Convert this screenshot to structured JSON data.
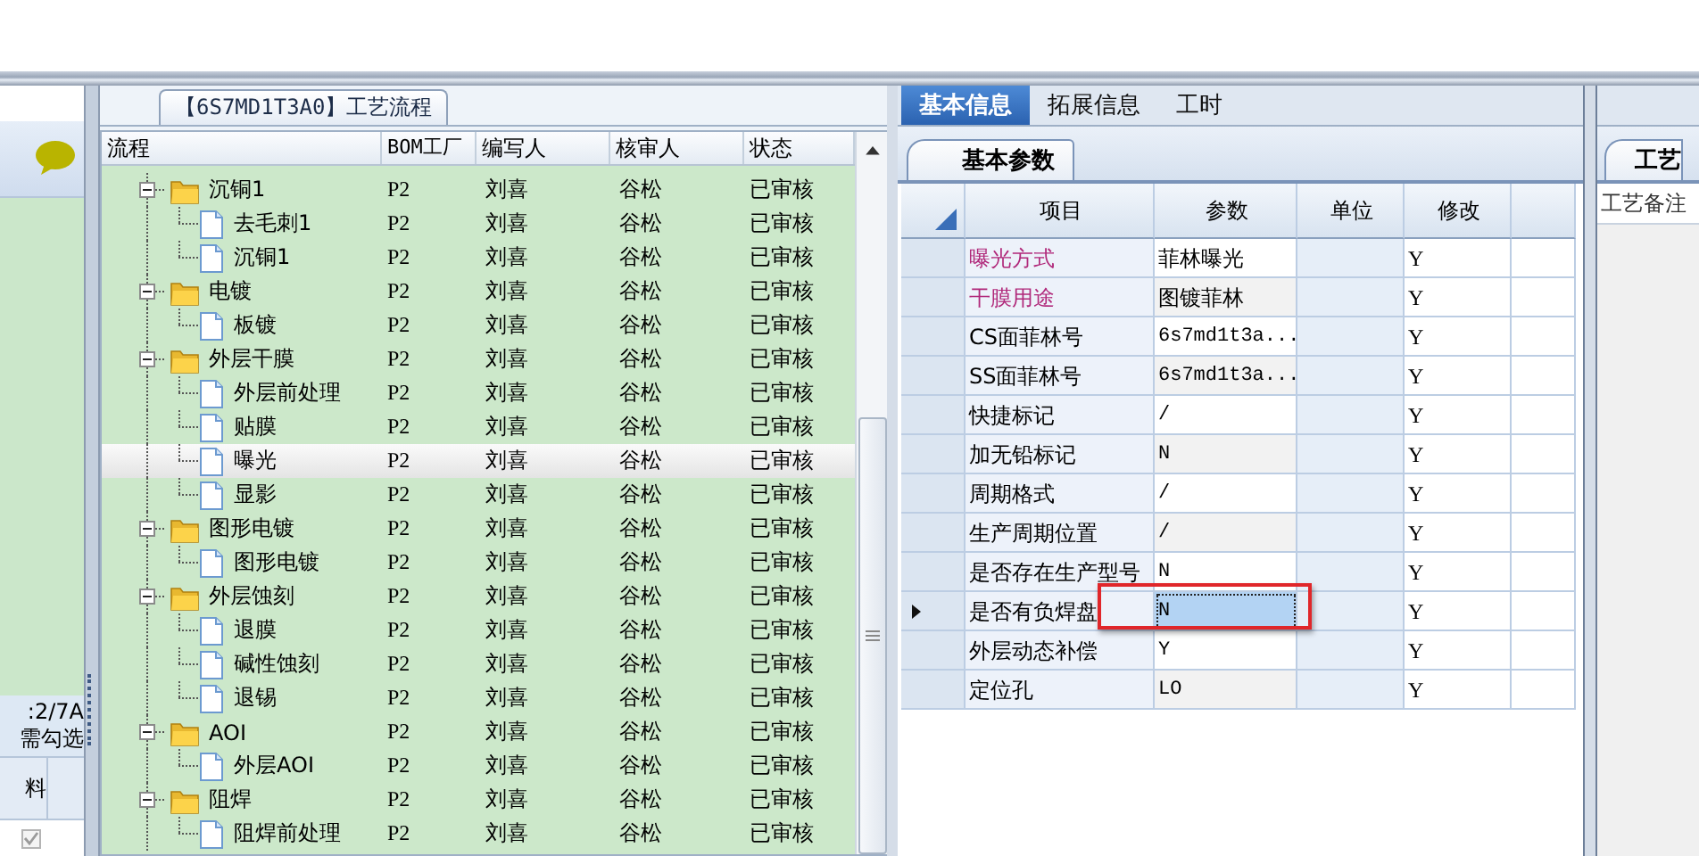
{
  "left_panel": {
    "summary": ":2/7A",
    "hint": "需勾选",
    "column_1": "料",
    "rows": [
      {
        "checked": true
      }
    ]
  },
  "flow": {
    "title": "【6S7MD1T3A0】工艺流程",
    "columns": [
      "流程",
      "BOM工厂",
      "编写人",
      "核审人",
      "状态"
    ],
    "tree": [
      {
        "label": "沉铜1",
        "bom": "P2",
        "author": "刘喜",
        "reviewer": "谷松",
        "status": "已审核",
        "expanded": true,
        "selected": false,
        "children": [
          {
            "label": "去毛刺1",
            "bom": "P2",
            "author": "刘喜",
            "reviewer": "谷松",
            "status": "已审核",
            "selected": false
          },
          {
            "label": "沉铜1",
            "bom": "P2",
            "author": "刘喜",
            "reviewer": "谷松",
            "status": "已审核",
            "selected": false
          }
        ]
      },
      {
        "label": "电镀",
        "bom": "P2",
        "author": "刘喜",
        "reviewer": "谷松",
        "status": "已审核",
        "expanded": true,
        "selected": false,
        "children": [
          {
            "label": "板镀",
            "bom": "P2",
            "author": "刘喜",
            "reviewer": "谷松",
            "status": "已审核",
            "selected": false
          }
        ]
      },
      {
        "label": "外层干膜",
        "bom": "P2",
        "author": "刘喜",
        "reviewer": "谷松",
        "status": "已审核",
        "expanded": true,
        "selected": false,
        "children": [
          {
            "label": "外层前处理",
            "bom": "P2",
            "author": "刘喜",
            "reviewer": "谷松",
            "status": "已审核",
            "selected": false
          },
          {
            "label": "贴膜",
            "bom": "P2",
            "author": "刘喜",
            "reviewer": "谷松",
            "status": "已审核",
            "selected": false
          },
          {
            "label": "曝光",
            "bom": "P2",
            "author": "刘喜",
            "reviewer": "谷松",
            "status": "已审核",
            "selected": true
          },
          {
            "label": "显影",
            "bom": "P2",
            "author": "刘喜",
            "reviewer": "谷松",
            "status": "已审核",
            "selected": false
          }
        ]
      },
      {
        "label": "图形电镀",
        "bom": "P2",
        "author": "刘喜",
        "reviewer": "谷松",
        "status": "已审核",
        "expanded": true,
        "selected": false,
        "children": [
          {
            "label": "图形电镀",
            "bom": "P2",
            "author": "刘喜",
            "reviewer": "谷松",
            "status": "已审核",
            "selected": false
          }
        ]
      },
      {
        "label": "外层蚀刻",
        "bom": "P2",
        "author": "刘喜",
        "reviewer": "谷松",
        "status": "已审核",
        "expanded": true,
        "selected": false,
        "children": [
          {
            "label": "退膜",
            "bom": "P2",
            "author": "刘喜",
            "reviewer": "谷松",
            "status": "已审核",
            "selected": false
          },
          {
            "label": "碱性蚀刻",
            "bom": "P2",
            "author": "刘喜",
            "reviewer": "谷松",
            "status": "已审核",
            "selected": false
          },
          {
            "label": "退锡",
            "bom": "P2",
            "author": "刘喜",
            "reviewer": "谷松",
            "status": "已审核",
            "selected": false
          }
        ]
      },
      {
        "label": "AOI",
        "bom": "P2",
        "author": "刘喜",
        "reviewer": "谷松",
        "status": "已审核",
        "expanded": true,
        "selected": false,
        "children": [
          {
            "label": "外层AOI",
            "bom": "P2",
            "author": "刘喜",
            "reviewer": "谷松",
            "status": "已审核",
            "selected": false
          }
        ]
      },
      {
        "label": "阻焊",
        "bom": "P2",
        "author": "刘喜",
        "reviewer": "谷松",
        "status": "已审核",
        "expanded": true,
        "selected": false,
        "children": [
          {
            "label": "阻焊前处理",
            "bom": "P2",
            "author": "刘喜",
            "reviewer": "谷松",
            "status": "已审核",
            "selected": false
          }
        ]
      }
    ]
  },
  "params": {
    "tabs": [
      {
        "label": "基本信息",
        "selected": true
      },
      {
        "label": "拓展信息",
        "selected": false
      },
      {
        "label": "工时",
        "selected": false
      }
    ],
    "subtab": "基本参数",
    "columns": [
      "项目",
      "参数",
      "单位",
      "修改"
    ],
    "rows": [
      {
        "item": "曝光方式",
        "value": "菲林曝光",
        "modified": "Y",
        "color": "#b0287a",
        "current": false,
        "selected": false,
        "marked": false
      },
      {
        "item": "干膜用途",
        "value": "图镀菲林",
        "modified": "Y",
        "color": "#b0287a",
        "current": false,
        "selected": false,
        "marked": false
      },
      {
        "item": "CS面菲林号",
        "value": "6s7md1t3a...",
        "modified": "Y",
        "color": "#000000",
        "current": false,
        "selected": false,
        "marked": false
      },
      {
        "item": "SS面菲林号",
        "value": "6s7md1t3a...",
        "modified": "Y",
        "color": "#000000",
        "current": false,
        "selected": false,
        "marked": false
      },
      {
        "item": "快捷标记",
        "value": "/",
        "modified": "Y",
        "color": "#000000",
        "current": false,
        "selected": false,
        "marked": false
      },
      {
        "item": "加无铅标记",
        "value": "N",
        "modified": "Y",
        "color": "#000000",
        "current": false,
        "selected": false,
        "marked": false
      },
      {
        "item": "周期格式",
        "value": "/",
        "modified": "Y",
        "color": "#000000",
        "current": false,
        "selected": false,
        "marked": false
      },
      {
        "item": "生产周期位置",
        "value": "/",
        "modified": "Y",
        "color": "#000000",
        "current": false,
        "selected": false,
        "marked": false
      },
      {
        "item": "是否存在生产型号",
        "value": "N",
        "modified": "Y",
        "color": "#000000",
        "current": false,
        "selected": false,
        "marked": false
      },
      {
        "item": "是否有负焊盘",
        "value": "N",
        "modified": "Y",
        "color": "#000000",
        "current": true,
        "selected": true,
        "marked": true
      },
      {
        "item": "外层动态补偿",
        "value": "Y",
        "modified": "Y",
        "color": "#000000",
        "current": false,
        "selected": false,
        "marked": false
      },
      {
        "item": "定位孔",
        "value": "LO",
        "modified": "Y",
        "color": "#000000",
        "current": false,
        "selected": false,
        "marked": false
      }
    ]
  },
  "note_panel": {
    "tab": "工艺",
    "label": "工艺备注"
  }
}
